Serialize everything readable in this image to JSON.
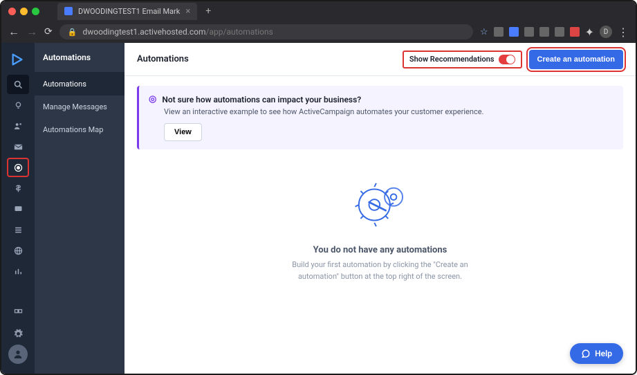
{
  "browser": {
    "tab_title": "DWOODINGTEST1 Email Mark",
    "url_host": "dwoodingtest1.activehosted.com",
    "url_path": "/app/automations",
    "avatar_initial": "D"
  },
  "subnav": {
    "header": "Automations",
    "items": [
      {
        "label": "Automations"
      },
      {
        "label": "Manage Messages"
      },
      {
        "label": "Automations Map"
      }
    ]
  },
  "header": {
    "title": "Automations",
    "recs_label": "Show Recommendations",
    "create_label": "Create an automation"
  },
  "banner": {
    "title": "Not sure how automations can impact your business?",
    "subtitle": "View an interactive example to see how ActiveCampaign automates your customer experience.",
    "button": "View"
  },
  "empty": {
    "title": "You do not have any automations",
    "text": "Build your first automation by clicking the \"Create an automation\" button at the top right of the screen."
  },
  "help": {
    "label": "Help"
  }
}
